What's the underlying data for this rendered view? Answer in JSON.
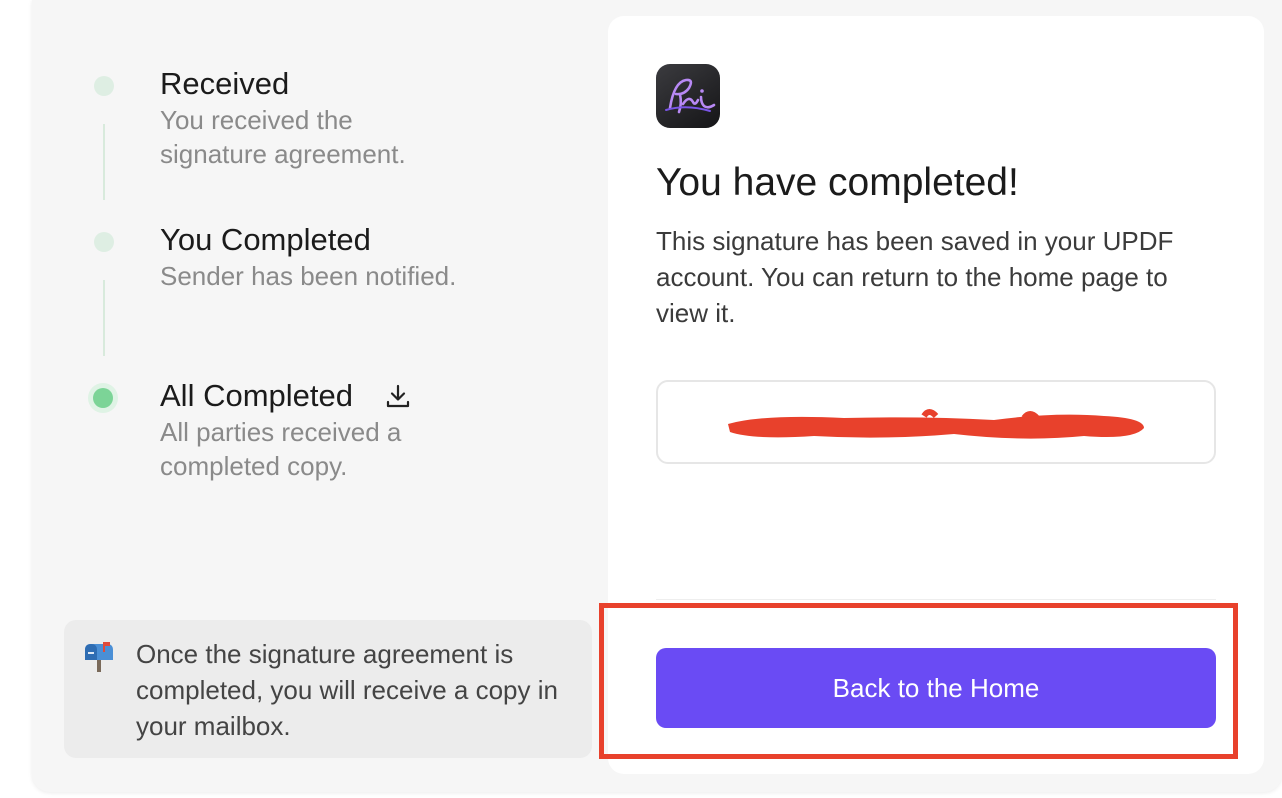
{
  "steps": [
    {
      "title": "Received",
      "description": "You received the signature agreement.",
      "status": "pending"
    },
    {
      "title": "You Completed",
      "description": "Sender has been notified.",
      "status": "pending"
    },
    {
      "title": "All Completed",
      "description": "All parties received a completed copy.",
      "status": "done",
      "icon": "download-icon"
    }
  ],
  "notice": {
    "icon": "mailbox-icon",
    "text": "Once the signature agreement is completed, you will receive a copy in your mailbox."
  },
  "panel": {
    "logo": "updf-sign-logo",
    "title": "You have completed!",
    "description": "This signature has been saved in your UPDF account. You can return to the home page to view it.",
    "email": "[redacted]",
    "button_label": "Back to the Home"
  },
  "colors": {
    "accent": "#6a4bf4",
    "step_done": "#7cd497",
    "step_pending": "#deeee3",
    "highlight": "#e8412c",
    "redaction": "#e8412c"
  }
}
